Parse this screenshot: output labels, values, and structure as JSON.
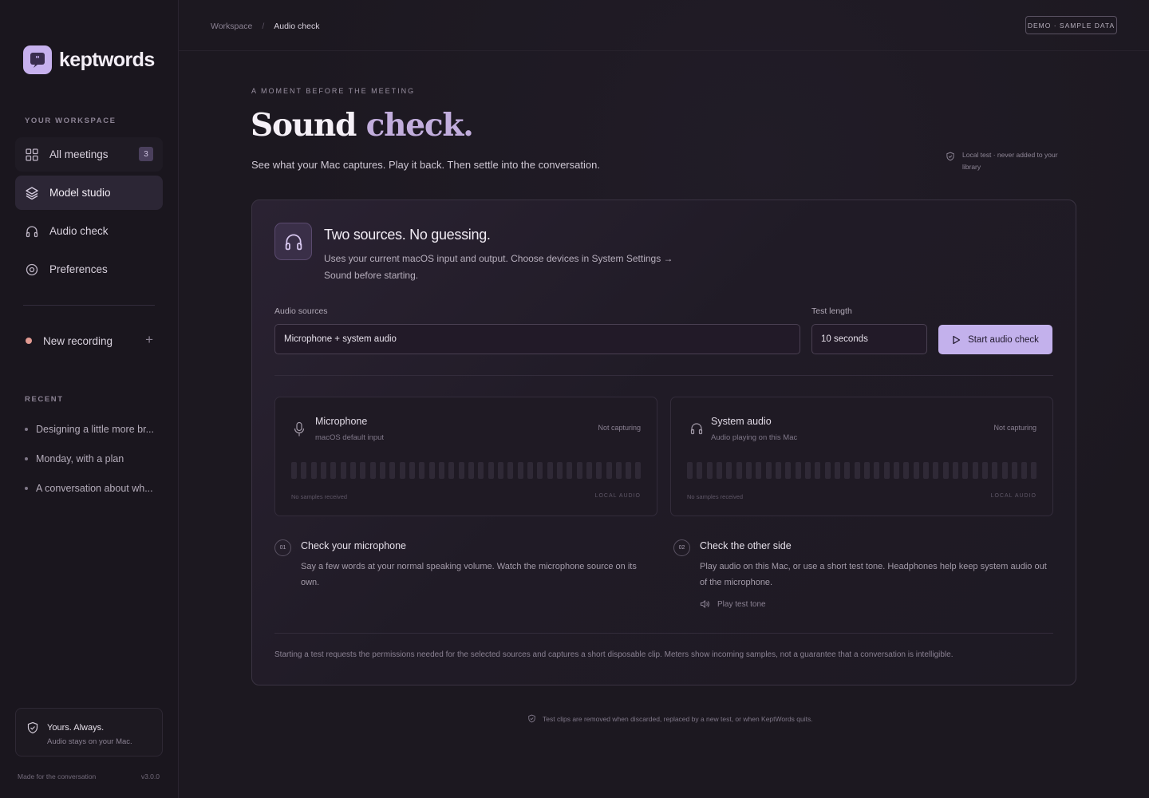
{
  "brand": {
    "name": "keptwords"
  },
  "sidebar": {
    "workspace_label": "YOUR WORKSPACE",
    "items": [
      {
        "label": "All meetings",
        "badge": "3"
      },
      {
        "label": "Model studio"
      },
      {
        "label": "Audio check"
      },
      {
        "label": "Preferences"
      }
    ],
    "new_recording": {
      "label": "New recording",
      "plus": "+"
    },
    "recent_label": "RECENT",
    "recent": [
      "Designing a little more br...",
      "Monday, with a plan",
      "A conversation about wh..."
    ],
    "privacy_card": {
      "title": "Yours. Always.",
      "subtitle": "Audio stays on your Mac."
    },
    "footer_left": "Made for the conversation",
    "footer_right": "v3.0.0"
  },
  "topbar": {
    "breadcrumb": {
      "root": "Workspace",
      "sep": "/",
      "current": "Audio check"
    },
    "demo_badge": "DEMO · SAMPLE DATA"
  },
  "hero": {
    "eyebrow": "A MOMENT BEFORE THE MEETING",
    "title_main": "Sound",
    "title_accent": "check.",
    "subtitle": "See what your Mac captures. Play it back. Then settle into the conversation.",
    "local_note": "Local test · never added to your library"
  },
  "panel": {
    "title": "Two sources. No guessing.",
    "description": "Uses your current macOS input and output. Choose devices in System Settings → Sound before starting.",
    "sources_label": "Audio sources",
    "sources_value": "Microphone + system audio",
    "length_label": "Test length",
    "length_value": "10 seconds",
    "start_button": "Start audio check",
    "meters": [
      {
        "title": "Microphone",
        "subtitle": "macOS default input",
        "status": "Not capturing",
        "foot_left": "No samples received",
        "foot_right": "LOCAL AUDIO",
        "level": 0
      },
      {
        "title": "System audio",
        "subtitle": "Audio playing on this Mac",
        "status": "Not capturing",
        "foot_left": "No samples received",
        "foot_right": "LOCAL AUDIO",
        "level": 0
      }
    ],
    "steps": [
      {
        "num": "01",
        "title": "Check your microphone",
        "desc": "Say a few words at your normal speaking volume. Watch the microphone source on its own."
      },
      {
        "num": "02",
        "title": "Check the other side",
        "desc": "Play audio on this Mac, or use a short test tone. Headphones help keep system audio out of the microphone.",
        "link": "Play test tone"
      }
    ],
    "note": "Starting a test requests the permissions needed for the selected sources and captures a short disposable clip. Meters show incoming samples, not a guarantee that a conversation is intelligible."
  },
  "bottom_note": "Test clips are removed when discarded, replaced by a new test, or when KeptWords quits.",
  "colors": {
    "accent": "#c3b1ec",
    "record_dot": "#e29a92",
    "background": "#1c1820"
  }
}
